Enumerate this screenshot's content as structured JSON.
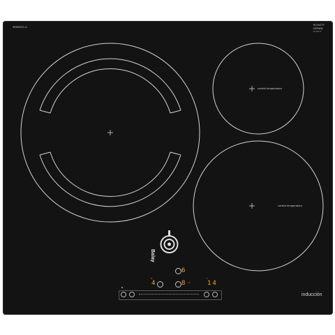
{
  "hob": {
    "model_code": "3EB967LU",
    "glass_brand": [
      "SCHOTT",
      "CERAN"
    ],
    "glass_sub": "SCHOTT",
    "brand_name": "Balay",
    "type_label": "inducción"
  },
  "zones": {
    "right_top_label": "control temperatura",
    "right_bottom_label": "control temperatura"
  },
  "display": {
    "zone_a_level": "4",
    "zone_b_level": "6",
    "zone_c_level": "8",
    "timer_value": "14"
  },
  "colors": {
    "glass": "#131313",
    "lines": "#d0d0d0",
    "display": "#f4a33a"
  }
}
